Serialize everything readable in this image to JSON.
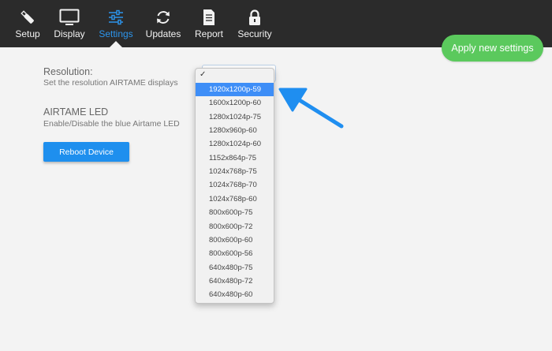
{
  "nav": {
    "items": [
      {
        "label": "Setup",
        "icon": "usb-stick-icon"
      },
      {
        "label": "Display",
        "icon": "monitor-icon"
      },
      {
        "label": "Settings",
        "icon": "sliders-icon"
      },
      {
        "label": "Updates",
        "icon": "refresh-icon"
      },
      {
        "label": "Report",
        "icon": "document-icon"
      },
      {
        "label": "Security",
        "icon": "lock-icon"
      }
    ],
    "active": "Settings"
  },
  "apply_button": {
    "label": "Apply new settings"
  },
  "resolution": {
    "title": "Resolution:",
    "description": "Set the resolution AIRTAME displays",
    "check_mark": "✓",
    "options": [
      "1920x1200p-59",
      "1600x1200p-60",
      "1280x1024p-75",
      "1280x960p-60",
      "1280x1024p-60",
      "1152x864p-75",
      "1024x768p-75",
      "1024x768p-70",
      "1024x768p-60",
      "800x600p-75",
      "800x600p-72",
      "800x600p-60",
      "800x600p-56",
      "640x480p-75",
      "640x480p-72",
      "640x480p-60"
    ],
    "highlighted": "1920x1200p-59"
  },
  "led": {
    "title": "AIRTAME LED",
    "description": "Enable/Disable the blue Airtame LED"
  },
  "reboot_button": {
    "label": "Reboot Device"
  },
  "colors": {
    "topbar": "#2b2b2b",
    "accent": "#2c95ec",
    "apply": "#5bc95d",
    "highlight": "#3e8ef7",
    "arrow": "#1f8ef0"
  }
}
